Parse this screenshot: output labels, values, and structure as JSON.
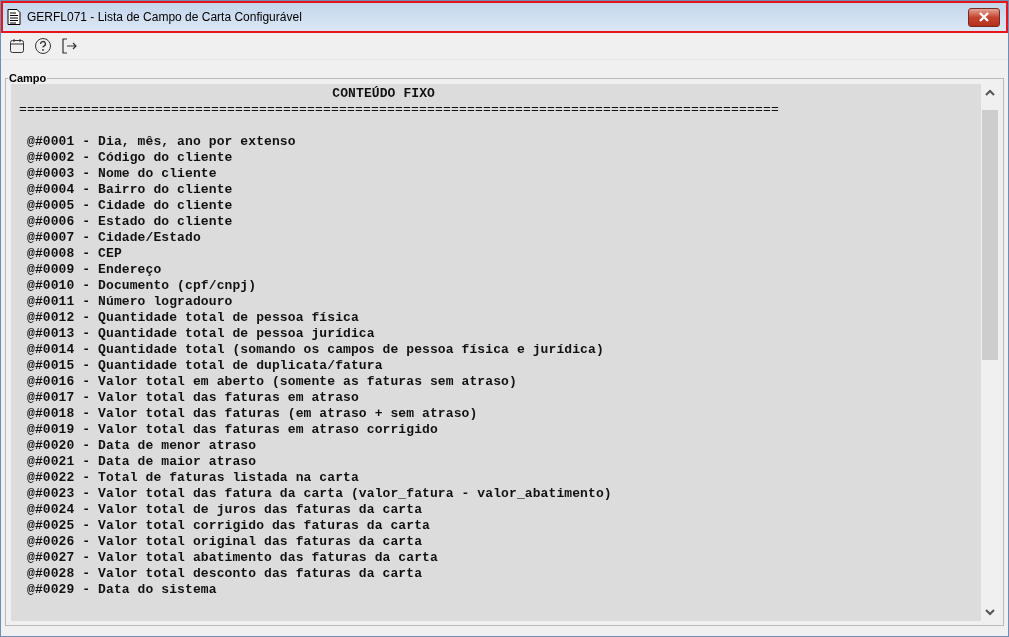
{
  "window": {
    "title": "GERFL071 - Lista de Campo de Carta Configurável"
  },
  "group": {
    "legend": "Campo"
  },
  "content": {
    "heading": "CONTEÚDO FIXO",
    "separator": "===============================================================================================",
    "lines": [
      "@#0001 - Dia, mês, ano por extenso",
      "@#0002 - Código do cliente",
      "@#0003 - Nome do cliente",
      "@#0004 - Bairro do cliente",
      "@#0005 - Cidade do cliente",
      "@#0006 - Estado do cliente",
      "@#0007 - Cidade/Estado",
      "@#0008 - CEP",
      "@#0009 - Endereço",
      "@#0010 - Documento (cpf/cnpj)",
      "@#0011 - Número logradouro",
      "@#0012 - Quantidade total de pessoa física",
      "@#0013 - Quantidade total de pessoa jurídica",
      "@#0014 - Quantidade total (somando os campos de pessoa física e jurídica)",
      "@#0015 - Quantidade total de duplicata/fatura",
      "@#0016 - Valor total em aberto (somente as faturas sem atraso)",
      "@#0017 - Valor total das faturas em atraso",
      "@#0018 - Valor total das faturas (em atraso + sem atraso)",
      "@#0019 - Valor total das faturas em atraso corrigido",
      "@#0020 - Data de menor atraso",
      "@#0021 - Data de maior atraso",
      "@#0022 - Total de faturas listada na carta",
      "@#0023 - Valor total das fatura da carta (valor_fatura - valor_abatimento)",
      "@#0024 - Valor total de juros das faturas da carta",
      "@#0025 - Valor total corrigido das faturas da carta",
      "@#0026 - Valor total original das faturas da carta",
      "@#0027 - Valor total abatimento das faturas da carta",
      "@#0028 - Valor total desconto das faturas da carta",
      "@#0029 - Data do sistema"
    ]
  }
}
